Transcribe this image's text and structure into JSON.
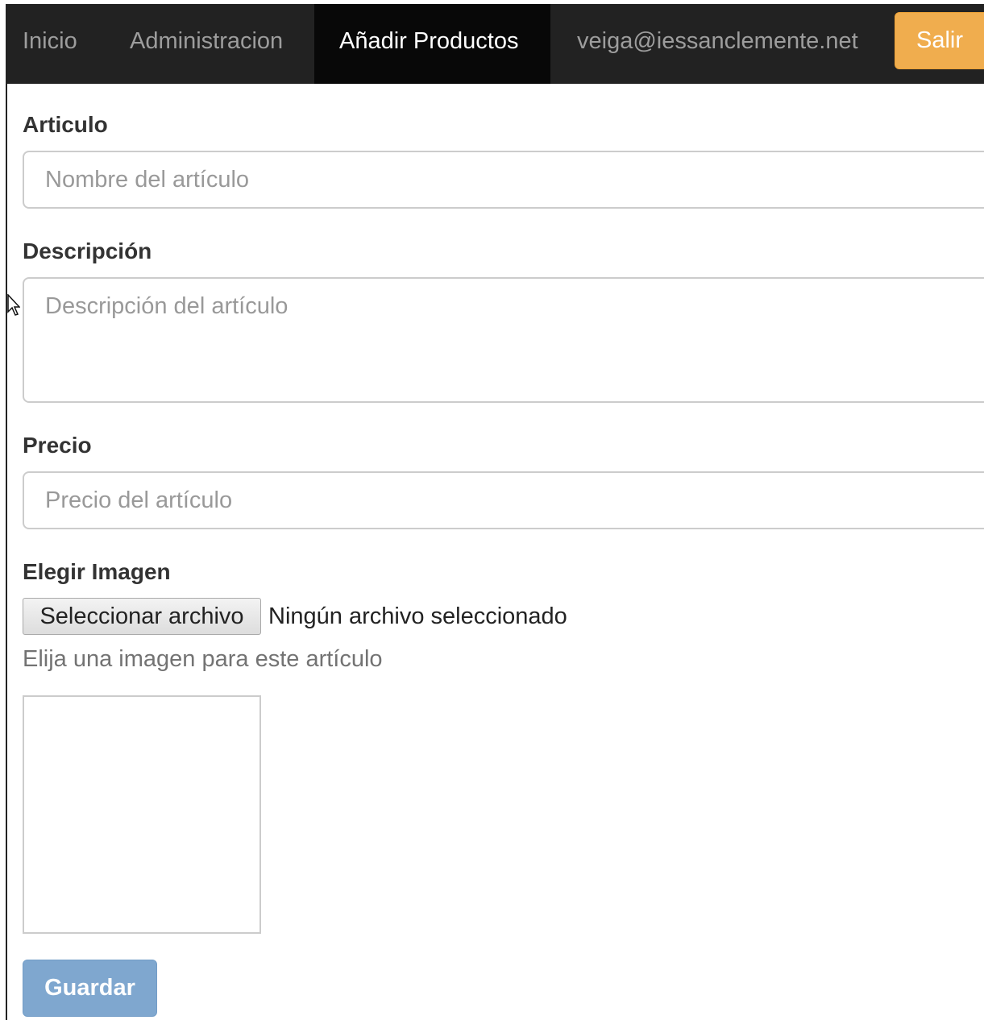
{
  "navbar": {
    "items": [
      {
        "label": "Inicio",
        "active": false
      },
      {
        "label": "Administracion",
        "active": false
      },
      {
        "label": "Añadir Productos",
        "active": true
      },
      {
        "label": "veiga@iessanclemente.net",
        "active": false
      }
    ],
    "logout_label": "Salir"
  },
  "form": {
    "articulo": {
      "label": "Articulo",
      "placeholder": "Nombre del artículo",
      "value": ""
    },
    "descripcion": {
      "label": "Descripción",
      "placeholder": "Descripción del artículo",
      "value": ""
    },
    "precio": {
      "label": "Precio",
      "placeholder": "Precio del artículo",
      "value": ""
    },
    "imagen": {
      "label": "Elegir Imagen",
      "button_label": "Seleccionar archivo",
      "status": "Ningún archivo seleccionado",
      "help": "Elija una imagen para este artículo"
    },
    "submit_label": "Guardar"
  },
  "colors": {
    "navbar_bg": "#222222",
    "navbar_active_bg": "#080808",
    "warning": "#f0ad4e",
    "primary_disabled": "#7fa7cf"
  }
}
